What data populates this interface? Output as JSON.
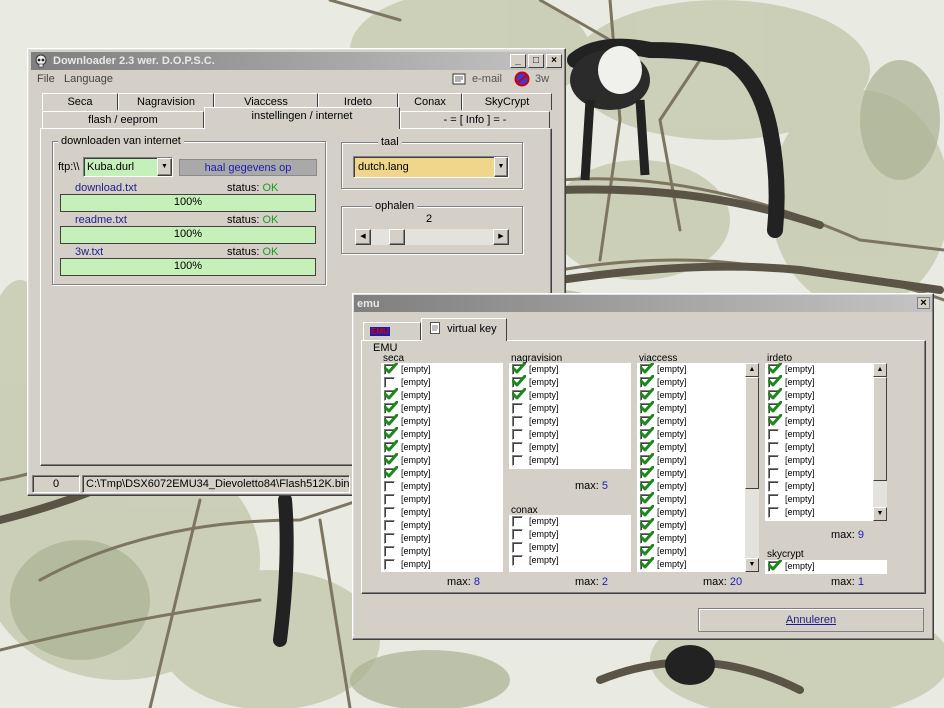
{
  "downloader": {
    "title": "Downloader 2.3 wer. D.O.P.S.C.",
    "menu": {
      "file": "File",
      "language": "Language",
      "email": "e-mail",
      "web": "3w"
    },
    "tabs_row1": [
      "Seca",
      "Nagravision",
      "Viaccess",
      "Irdeto",
      "Conax",
      "SkyCrypt"
    ],
    "tabs_row2": [
      "flash / eeprom",
      "instellingen / internet",
      "- = [ Info ] = -"
    ],
    "internet": {
      "group": "downloaden van internet",
      "prefix": "ftp:\\\\",
      "server": "Kuba.durl",
      "fetch_button": "haal gegevens op",
      "status_label": "status:",
      "files": [
        {
          "name": "download.txt",
          "status": "OK",
          "progress": "100%",
          "progress_value": 100
        },
        {
          "name": "readme.txt",
          "status": "OK",
          "progress": "100%",
          "progress_value": 100
        },
        {
          "name": "3w.txt",
          "status": "OK",
          "progress": "100%",
          "progress_value": 100
        }
      ]
    },
    "language": {
      "group": "taal",
      "value": "dutch.lang"
    },
    "fetch": {
      "group": "ophalen",
      "value": "2"
    },
    "statusbar": {
      "count": "0",
      "path": "C:\\Tmp\\DSX6072EMU34_Dievoletto84\\Flash512K.bin"
    }
  },
  "emu": {
    "title": "emu",
    "tabs": [
      "EMU",
      "virtual key"
    ],
    "empty": "[empty]",
    "max_label": "max:",
    "seca": {
      "label": "seca",
      "max": "8",
      "checked": [
        true,
        false,
        true,
        true,
        true,
        true,
        true,
        true,
        true,
        false,
        false,
        false,
        false,
        false,
        false,
        false
      ]
    },
    "nagravision": {
      "label": "nagravision",
      "max": "5",
      "checked": [
        true,
        true,
        true,
        false,
        false,
        false,
        false,
        false
      ]
    },
    "conax": {
      "label": "conax",
      "max": "2",
      "checked": [
        false,
        false,
        false,
        false
      ]
    },
    "viaccess": {
      "label": "viaccess",
      "max": "20",
      "checked": [
        true,
        true,
        true,
        true,
        true,
        true,
        true,
        true,
        true,
        true,
        true,
        true,
        true,
        true,
        true,
        true
      ]
    },
    "irdeto": {
      "label": "irdeto",
      "max": "9",
      "checked": [
        true,
        true,
        true,
        true,
        true,
        false,
        false,
        false,
        false,
        false,
        false,
        false
      ]
    },
    "skycrypt": {
      "label": "skycrypt",
      "max": "1",
      "checked": [
        true
      ]
    },
    "cancel_button": "Annuleren"
  }
}
